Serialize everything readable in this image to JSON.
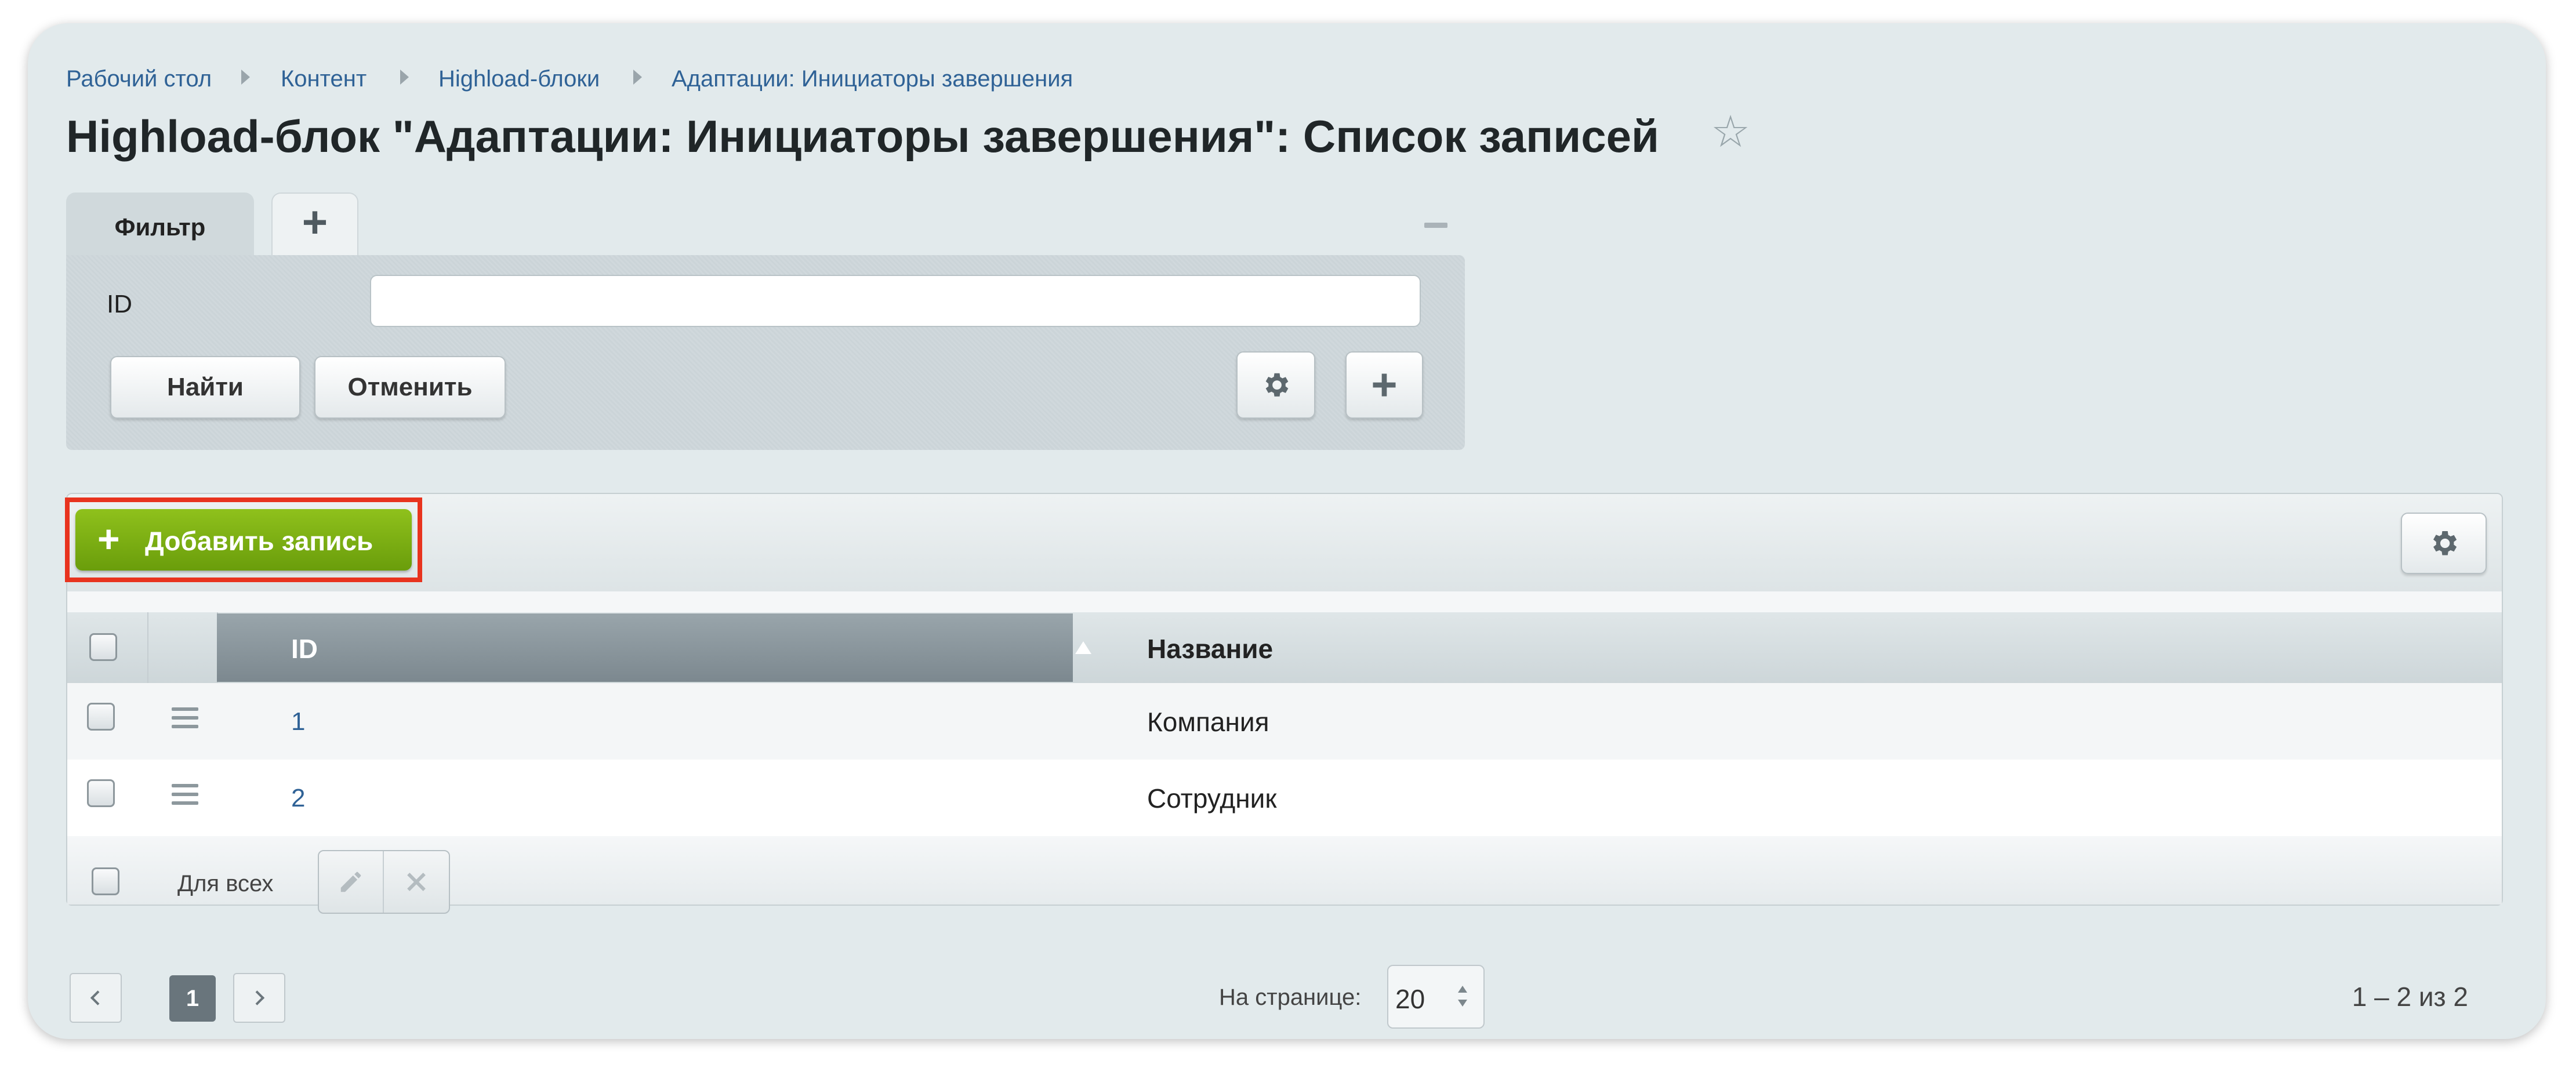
{
  "breadcrumb": [
    {
      "label": "Рабочий стол"
    },
    {
      "label": "Контент"
    },
    {
      "label": "Highload-блоки"
    },
    {
      "label": "Адаптации: Инициаторы завершения"
    }
  ],
  "page_title": "Highload-блок \"Адаптации: Инициаторы завершения\": Список записей",
  "favorite_icon": "star-icon",
  "filter": {
    "tab_label": "Фильтр",
    "add_tab_label": "+",
    "fields": [
      {
        "label": "ID",
        "value": "",
        "placeholder": ""
      }
    ],
    "find_button": "Найти",
    "cancel_button": "Отменить"
  },
  "toolbar": {
    "add_button": "Добавить запись",
    "add_icon": "+",
    "highlight_color": "#e8331e",
    "accent_color": "#7aad12"
  },
  "table": {
    "columns": [
      "ID",
      "Название"
    ],
    "sort": {
      "column": "ID",
      "direction": "asc"
    },
    "rows": [
      {
        "id": "1",
        "name": "Компания"
      },
      {
        "id": "2",
        "name": "Сотрудник"
      }
    ],
    "for_all_label": "Для всех"
  },
  "pagination": {
    "current_page": "1",
    "per_page_label": "На странице:",
    "per_page_value": "20",
    "range_text": "1 – 2 из 2"
  }
}
